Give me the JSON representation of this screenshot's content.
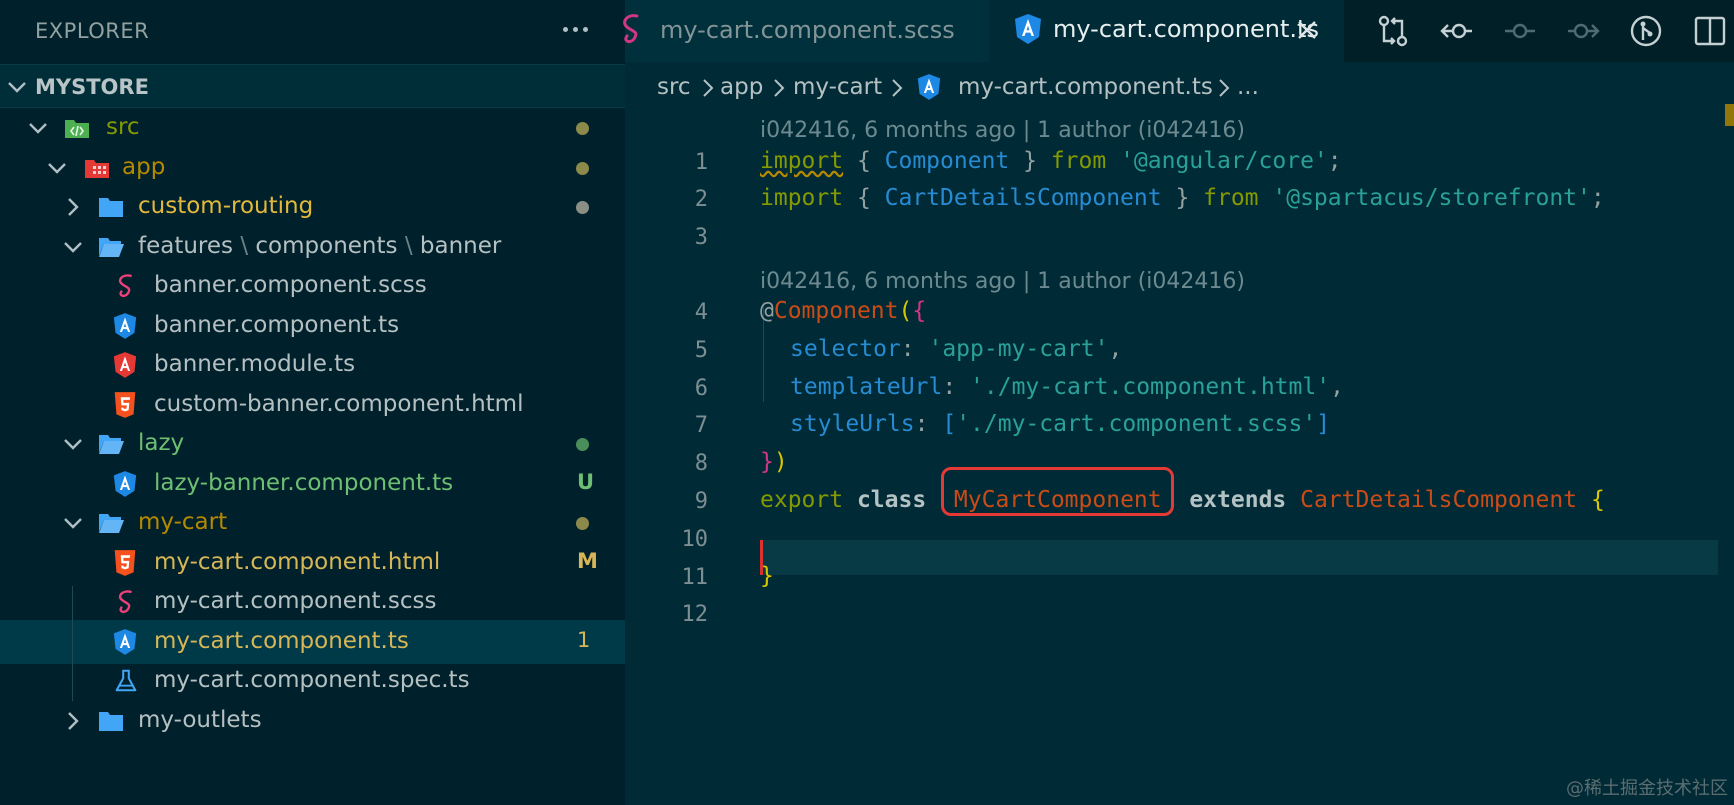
{
  "sidebar": {
    "title": "EXPLORER",
    "project": "MYSTORE",
    "tree": [
      {
        "label": "src",
        "indent": 1,
        "kind": "folder-src",
        "open": true,
        "color": "#859900",
        "badge": "dot"
      },
      {
        "label": "app",
        "indent": 2,
        "kind": "folder-app",
        "open": true,
        "color": "#b58900",
        "badge": "dot"
      },
      {
        "label": "custom-routing",
        "indent": 3,
        "kind": "folder",
        "open": false,
        "color": "#e2b93d",
        "badge": "dot-gray"
      },
      {
        "label": "features",
        "indent": 3,
        "kind": "folder",
        "open": true,
        "color": "#b5c0c2",
        "path2": "components",
        "path3": "banner"
      },
      {
        "label": "banner.component.scss",
        "indent": 4,
        "kind": "sass",
        "color": "#b5c0c2"
      },
      {
        "label": "banner.component.ts",
        "indent": 4,
        "kind": "angular-ts",
        "color": "#b5c0c2"
      },
      {
        "label": "banner.module.ts",
        "indent": 4,
        "kind": "angular-module",
        "color": "#b5c0c2"
      },
      {
        "label": "custom-banner.component.html",
        "indent": 4,
        "kind": "html",
        "color": "#b5c0c2"
      },
      {
        "label": "lazy",
        "indent": 3,
        "kind": "folder",
        "open": true,
        "color": "#6fbf73",
        "badge": "dot-green"
      },
      {
        "label": "lazy-banner.component.ts",
        "indent": 4,
        "kind": "angular-ts",
        "color": "#6fbf73",
        "badge": "U"
      },
      {
        "label": "my-cart",
        "indent": 3,
        "kind": "folder",
        "open": true,
        "color": "#b58900",
        "badge": "dot"
      },
      {
        "label": "my-cart.component.html",
        "indent": 4,
        "kind": "html",
        "color": "#d6b656",
        "badge": "M"
      },
      {
        "label": "my-cart.component.scss",
        "indent": 4,
        "kind": "sass",
        "color": "#b5c0c2"
      },
      {
        "label": "my-cart.component.ts",
        "indent": 4,
        "kind": "angular-ts",
        "color": "#d6b656",
        "badge": "1",
        "selected": true
      },
      {
        "label": "my-cart.component.spec.ts",
        "indent": 4,
        "kind": "flask",
        "color": "#b5c0c2"
      },
      {
        "label": "my-outlets",
        "indent": 3,
        "kind": "folder",
        "open": false,
        "color": "#b5c0c2"
      }
    ]
  },
  "tabs": [
    {
      "label": "my-cart.component.scss",
      "icon": "sass-icon",
      "active": false
    },
    {
      "label": "my-cart.component.ts",
      "icon": "angular-icon",
      "active": true
    }
  ],
  "toolbar_icons": [
    "compare-changes-icon",
    "go-back-icon",
    "commit-icon",
    "go-forward-icon",
    "git-graph-icon",
    "split-editor-icon"
  ],
  "breadcrumb": [
    "src",
    "app",
    "my-cart",
    "my-cart.component.ts",
    "..."
  ],
  "editor": {
    "blame1": "i042416, 6 months ago | 1 author (i042416)",
    "blame2": "i042416, 6 months ago | 1 author (i042416)",
    "line_numbers": [
      "1",
      "2",
      "3",
      "4",
      "5",
      "6",
      "7",
      "8",
      "9",
      "10",
      "11",
      "12"
    ],
    "line1": {
      "kw1": "import",
      "p1": " { ",
      "type": "Component",
      "p2": " } ",
      "kw2": "from",
      "sp": " ",
      "str": "'@angular/core'",
      "end": ";"
    },
    "line2": {
      "kw1": "import",
      "p1": " { ",
      "type": "CartDetailsComponent",
      "p2": " } ",
      "kw2": "from",
      "sp": " ",
      "str": "'@spartacus/storefront'",
      "end": ";"
    },
    "line4": {
      "at": "@",
      "dec": "Component",
      "b1": "(",
      "b2": "{"
    },
    "line5": {
      "prop": "selector",
      "colon": ": ",
      "str": "'app-my-cart'",
      "comma": ","
    },
    "line6": {
      "prop": "templateUrl",
      "colon": ": ",
      "str": "'./my-cart.component.html'",
      "comma": ","
    },
    "line7": {
      "prop": "styleUrls",
      "colon": ": ",
      "b1": "[",
      "str": "'./my-cart.component.scss'",
      "b2": "]"
    },
    "line8": {
      "b1": "}",
      "b2": ")"
    },
    "line9": {
      "kw": "export",
      "cls": "class",
      "name": "MyCartComponent",
      "ext": "extends",
      "parent": "CartDetailsComponent",
      "brace": "{"
    },
    "line11": {
      "brace": "}"
    }
  },
  "watermark": "@稀土掘金技术社区",
  "colors": {
    "background": "#002b36",
    "sidebar": "#00212b",
    "highlight": "#e53935"
  }
}
